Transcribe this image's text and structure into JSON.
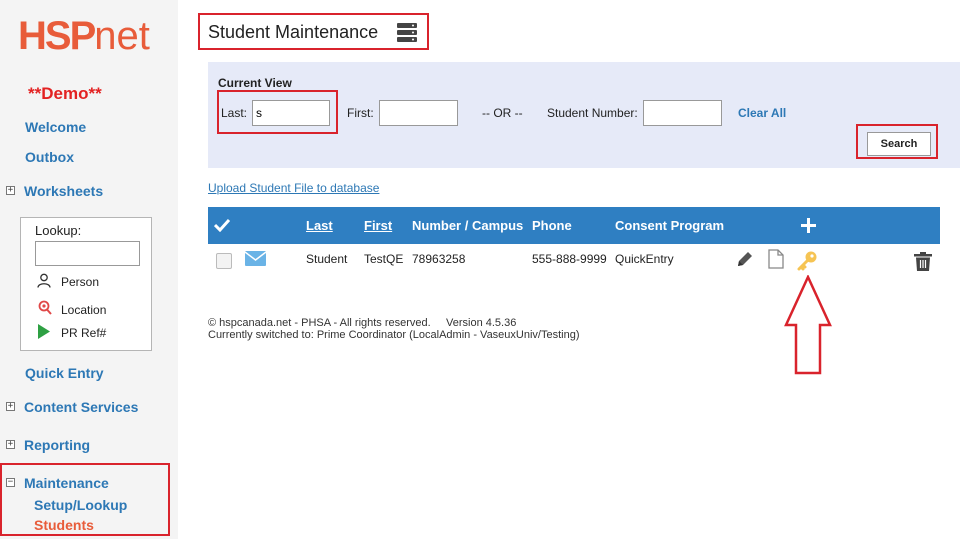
{
  "sidebar": {
    "logo_main": "HSP",
    "logo_suffix": "net",
    "demo": "**Demo**",
    "welcome": "Welcome",
    "outbox": "Outbox",
    "worksheets": "Worksheets",
    "lookup": {
      "title": "Lookup:",
      "person": "Person",
      "location": "Location",
      "pr_ref": "PR Ref#"
    },
    "quick_entry": "Quick Entry",
    "content_services": "Content Services",
    "reporting": "Reporting",
    "maintenance": "Maintenance",
    "setup_lookup": "Setup/Lookup",
    "students": "Students"
  },
  "page": {
    "title": "Student Maintenance"
  },
  "filter": {
    "current_view": "Current View",
    "last_label": "Last:",
    "last_value": "s",
    "first_label": "First:",
    "or": "-- OR --",
    "student_number_label": "Student Number:",
    "clear_all": "Clear All",
    "search": "Search"
  },
  "upload_link": "Upload Student File to database",
  "table": {
    "headers": {
      "last": "Last",
      "first": "First",
      "number_campus": "Number / Campus",
      "phone": "Phone",
      "consent_program": "Consent Program"
    },
    "rows": [
      {
        "last": "Student",
        "first": "TestQE",
        "number": "78963258",
        "phone": "555-888-9999",
        "consent_program": "QuickEntry"
      }
    ]
  },
  "footer": {
    "line1": "© hspcanada.net - PHSA - All rights reserved.     Version 4.5.36",
    "line2": "Currently switched to: Prime Coordinator (LocalAdmin - VaseuxUniv/Testing)"
  },
  "colors": {
    "brand": "#e85c3a",
    "link": "#2d78b5",
    "header_blue": "#2f7fc2",
    "highlight_red": "#d9232c",
    "key_icon": "#f6c453"
  }
}
